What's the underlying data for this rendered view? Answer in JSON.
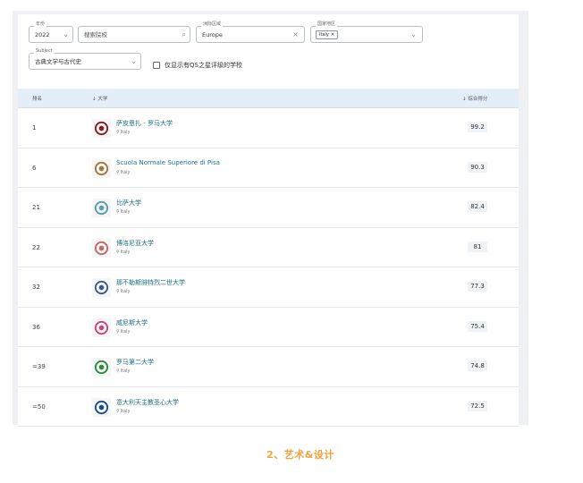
{
  "filters": {
    "year": {
      "label": "年份",
      "value": "2022"
    },
    "search": {
      "placeholder": "搜索院校"
    },
    "region": {
      "label": "洲际区域",
      "value": "Europe"
    },
    "country": {
      "label": "国家地区",
      "chip": "Italy"
    },
    "subject": {
      "label": "Subject",
      "value": "古典文学与古代史"
    },
    "checkbox_label": "仅显示有QS之星评级的学校"
  },
  "table": {
    "headers": {
      "rank": "排名",
      "university": "大学",
      "score": "综合得分"
    },
    "rows": [
      {
        "rank": "1",
        "name": "萨皮恩扎 - 罗马大学",
        "location": "Italy",
        "score": "99.2",
        "logo_color": "#8a1c23"
      },
      {
        "rank": "6",
        "name": "Scuola Normale Superiore di Pisa",
        "location": "Italy",
        "score": "90.3",
        "logo_color": "#9b7a3c"
      },
      {
        "rank": "21",
        "name": "比萨大学",
        "location": "Italy",
        "score": "82.4",
        "logo_color": "#5a9fb3"
      },
      {
        "rank": "22",
        "name": "博洛尼亚大学",
        "location": "Italy",
        "score": "81",
        "logo_color": "#c06a6a"
      },
      {
        "rank": "32",
        "name": "那不勒斯腓特烈二世大学",
        "location": "Italy",
        "score": "77.3",
        "logo_color": "#3f5d8a"
      },
      {
        "rank": "36",
        "name": "威尼斯大学",
        "location": "Italy",
        "score": "75.4",
        "logo_color": "#c9477e"
      },
      {
        "rank": "=39",
        "name": "罗马第二大学",
        "location": "Italy",
        "score": "74.8",
        "logo_color": "#2d8a3e"
      },
      {
        "rank": "=50",
        "name": "意大利天主教圣心大学",
        "location": "Italy",
        "score": "72.5",
        "logo_color": "#1c4f8a"
      }
    ]
  },
  "footer": {
    "title": "2、艺术&设计"
  }
}
